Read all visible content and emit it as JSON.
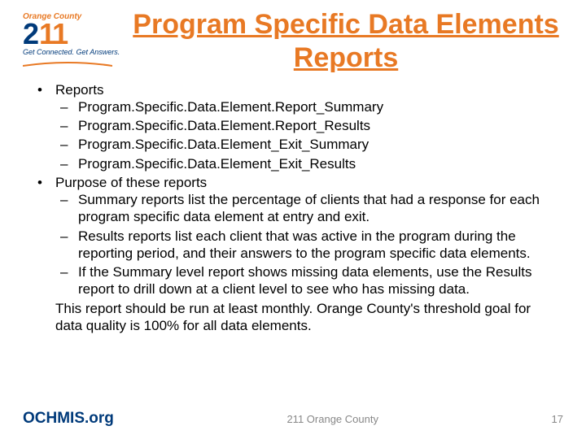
{
  "logo": {
    "region": "Orange County",
    "brand_2": "2",
    "brand_11": "11",
    "tagline": "Get Connected. Get Answers."
  },
  "title": "Program Specific Data Elements Reports",
  "bullets": {
    "reports_heading": "Reports",
    "reports": [
      "Program.Specific.Data.Element.Report_Summary",
      "Program.Specific.Data.Element.Report_Results",
      "Program.Specific.Data.Element_Exit_Summary",
      "Program.Specific.Data.Element_Exit_Results"
    ],
    "purpose_heading": "Purpose of these reports",
    "purpose": [
      "Summary reports list the percentage of clients that had a response for each program specific data element at entry and exit.",
      "Results reports list each client that was active in the program during the reporting period, and their answers to the program specific data elements.",
      "If the Summary level report shows missing data elements, use the Results report to drill down at a client level to see who has missing data."
    ],
    "closing": "This report should be run at least monthly. Orange County's threshold goal for data quality is 100% for all data elements."
  },
  "footer": {
    "left": "OCHMIS.org",
    "center": "211 Orange County",
    "right": "17"
  }
}
